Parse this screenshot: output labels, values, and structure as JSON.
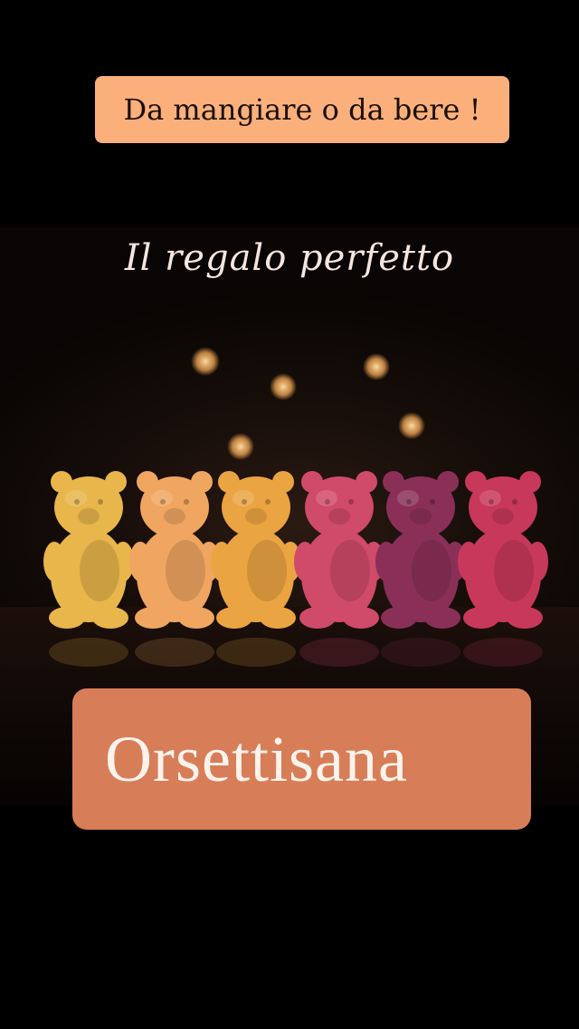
{
  "banner": {
    "text": "Da mangiare o da bere !",
    "color": "#fbb07c"
  },
  "subtitle": "Il regalo perfetto",
  "brand": {
    "text": "Orsettisana",
    "color": "#d77e58"
  },
  "photo": {
    "subject": "six gummy bear shaped soaps",
    "bear_colors": [
      "#e8b64a",
      "#f0a660",
      "#eba442",
      "#d04a6a",
      "#8a3058",
      "#c8385a"
    ]
  }
}
